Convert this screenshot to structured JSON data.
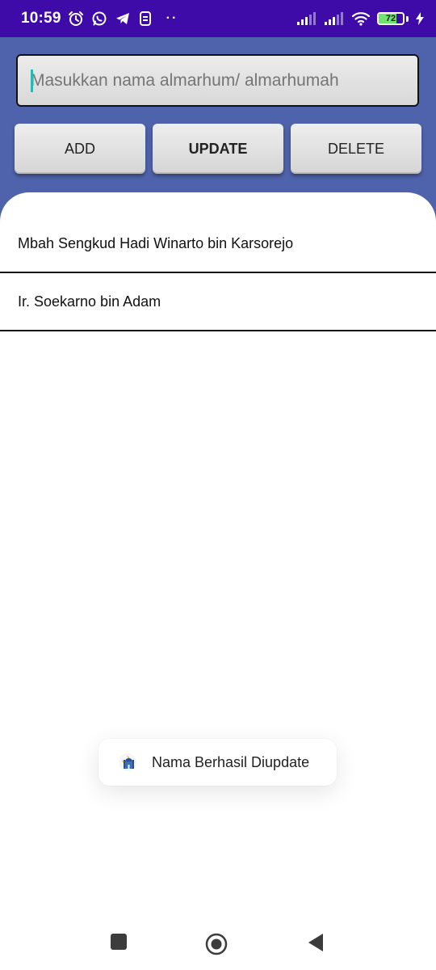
{
  "status_bar": {
    "time": "10:59",
    "more_indicator": "··",
    "battery_level": "72",
    "battery_fraction": 0.72,
    "icons": [
      "alarm-icon",
      "whatsapp-icon",
      "telegram-icon",
      "app-notification-icon",
      "signal-icon",
      "signal-icon",
      "wifi-icon",
      "battery-icon",
      "charging-icon"
    ]
  },
  "form": {
    "name_input_placeholder": "Masukkan nama almarhum/ almarhumah",
    "add_label": "ADD",
    "update_label": "UPDATE",
    "delete_label": "DELETE"
  },
  "names": [
    "Mbah Sengkud Hadi Winarto bin Karsorejo",
    "Ir. Soekarno bin Adam"
  ],
  "toast": {
    "message": "Nama Berhasil Diupdate",
    "icon": "mosque-app-icon"
  },
  "nav": [
    "recent-apps-icon",
    "home-icon",
    "back-icon"
  ],
  "colors": {
    "status_bar": "#3e0aa8",
    "header": "#4f63ac",
    "cursor": "#2bb8b0",
    "battery": "#6fe36f"
  }
}
